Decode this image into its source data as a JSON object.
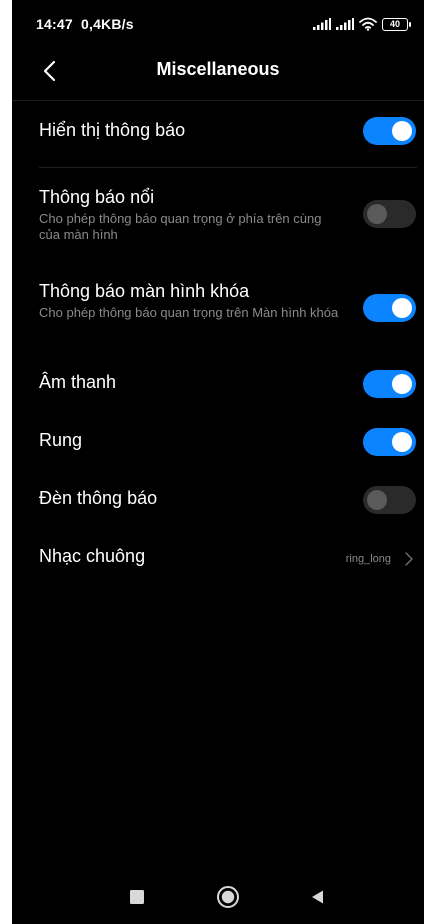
{
  "status_bar": {
    "time": "14:47",
    "speed": "0,4KB/s",
    "battery": "40"
  },
  "header": {
    "title": "Miscellaneous"
  },
  "settings": [
    {
      "title": "Hiển thị thông báo",
      "subtitle": "",
      "enabled": true
    },
    {
      "title": "Thông báo nổi",
      "subtitle": "Cho phép thông báo quan trọng ở phía trên cùng của màn hình",
      "enabled": false
    },
    {
      "title": "Thông báo màn hình khóa",
      "subtitle": "Cho phép thông báo quan trọng trên Màn hình khóa",
      "enabled": true
    },
    {
      "title": "Âm thanh",
      "subtitle": "",
      "enabled": true
    },
    {
      "title": "Rung",
      "subtitle": "",
      "enabled": true
    },
    {
      "title": "Đèn thông báo",
      "subtitle": "",
      "enabled": false
    }
  ],
  "ringtone": {
    "title": "Nhạc chuông",
    "value": "ring_long"
  },
  "colors": {
    "accent": "#0d84ff",
    "background": "#000000",
    "subtitle": "#8a8a8a"
  }
}
